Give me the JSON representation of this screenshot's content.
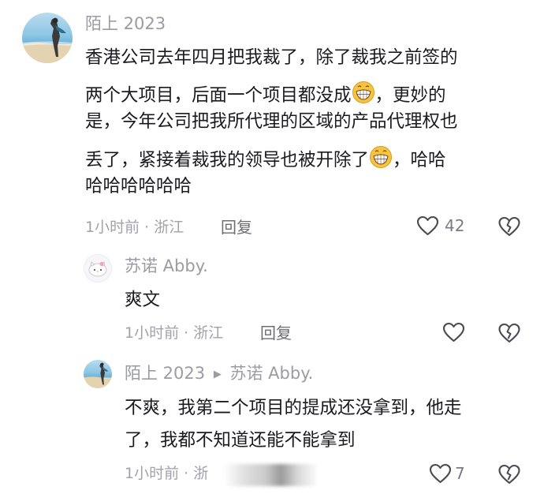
{
  "comments": {
    "main": {
      "author": "陌上 2023",
      "lines": [
        "香港公司去年四月把我裁了，除了裁我之前签的",
        "两个大项目，后面一个项目都没成",
        "，更妙的",
        "是，今年公司把我所代理的区域的产品代理权也",
        "丢了，紧接着裁我的领导也被开除了",
        "，哈哈",
        "哈哈哈哈哈哈"
      ],
      "time": "1小时前 · 浙江",
      "reply_label": "回复",
      "like_count": "42"
    },
    "reply1": {
      "author": "苏诺 Abby.",
      "text": "爽文",
      "time": "1小时前 · 浙江",
      "reply_label": "回复",
      "like_count": ""
    },
    "reply2": {
      "author": "陌上 2023",
      "arrow": "▶",
      "reply_to": "苏诺 Abby.",
      "lines": [
        "不爽，我第二个项目的提成还没拿到，他走",
        "了，我都不知道还能不能拿到"
      ],
      "time": "1小时前 · 浙",
      "like_count": "7"
    }
  },
  "icons": {
    "like": "heart-outline-icon",
    "dislike": "broken-heart-icon",
    "emoji": "grinning-face-emoji"
  },
  "colors": {
    "text": "#1b1b1f",
    "muted": "#9b9ba3",
    "emoji_face": "#f6c343"
  }
}
